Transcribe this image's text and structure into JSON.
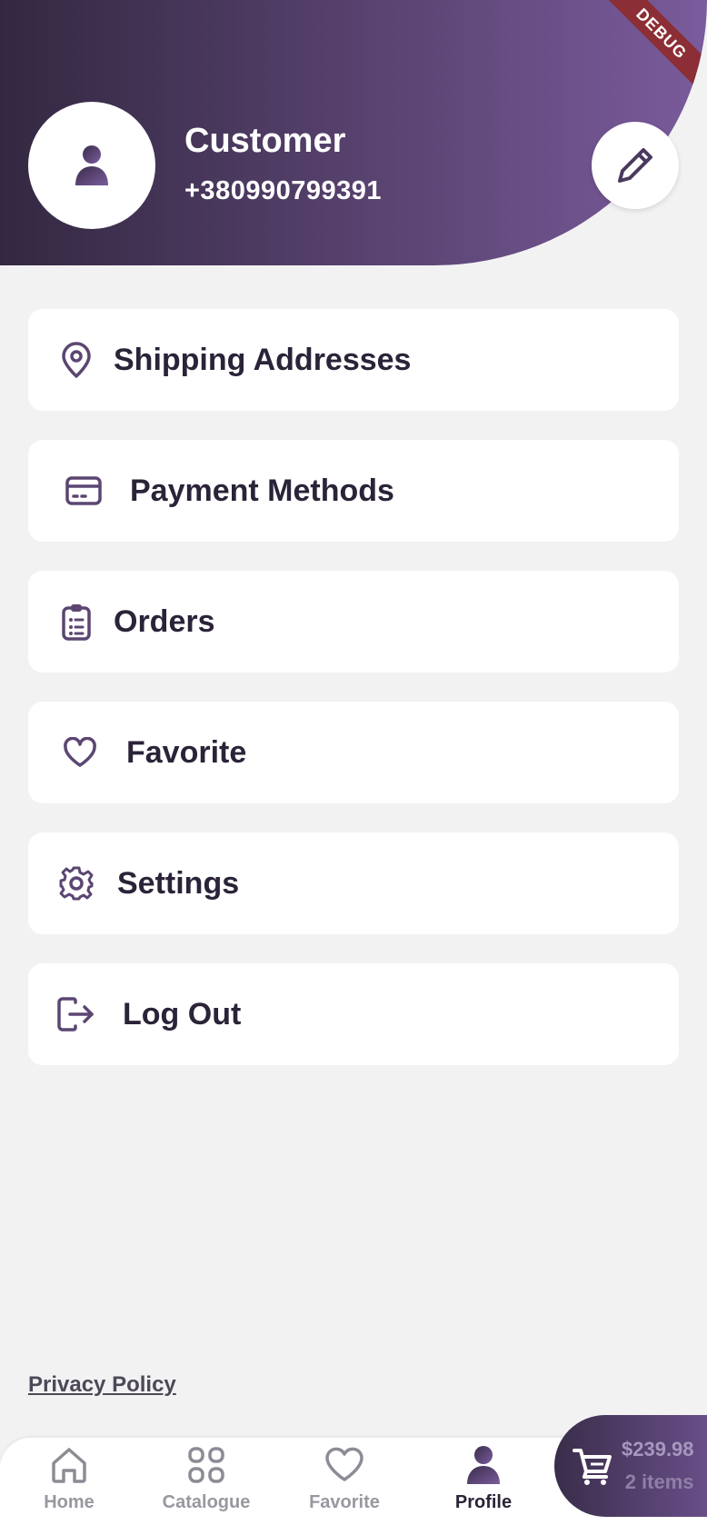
{
  "header": {
    "name": "Customer",
    "phone": "+380990799391",
    "debug_badge": "DEBUG",
    "accent_color": "#7a5b9c",
    "dark_color": "#332841"
  },
  "menu": [
    {
      "label": "Shipping Addresses",
      "icon": "location-pin-icon"
    },
    {
      "label": "Payment Methods",
      "icon": "credit-card-icon"
    },
    {
      "label": "Orders",
      "icon": "clipboard-list-icon"
    },
    {
      "label": "Favorite",
      "icon": "heart-icon"
    },
    {
      "label": "Settings",
      "icon": "gear-icon"
    },
    {
      "label": "Log Out",
      "icon": "logout-icon"
    }
  ],
  "footer": {
    "privacy_link": "Privacy Policy"
  },
  "bottom_nav": {
    "items": [
      {
        "label": "Home",
        "icon": "home-icon",
        "active": false
      },
      {
        "label": "Catalogue",
        "icon": "grid-icon",
        "active": false
      },
      {
        "label": "Favorite",
        "icon": "heart-icon",
        "active": false
      },
      {
        "label": "Profile",
        "icon": "person-icon",
        "active": true
      }
    ]
  },
  "cart": {
    "total": "$239.98",
    "items": "2 items",
    "icon": "cart-icon"
  }
}
